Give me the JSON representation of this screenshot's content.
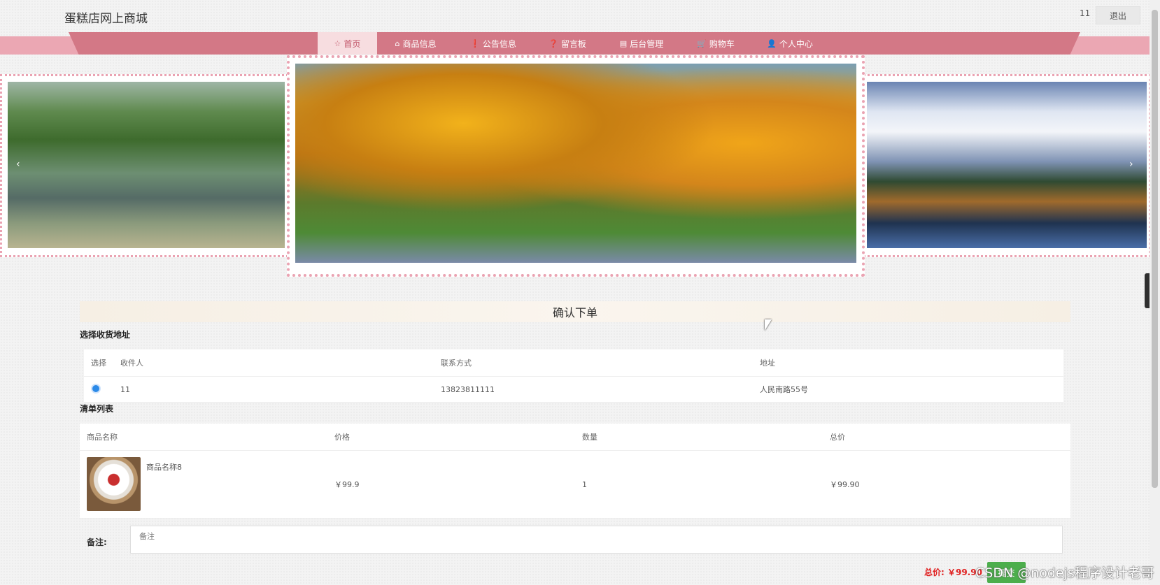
{
  "header": {
    "site_title": "蛋糕店网上商城",
    "user_name": "11",
    "logout_label": "退出"
  },
  "nav": [
    {
      "icon": "☆",
      "icon_name": "star-icon",
      "label": "首页",
      "active": true
    },
    {
      "icon": "⌂",
      "icon_name": "bag-icon",
      "label": "商品信息"
    },
    {
      "icon": "❗",
      "icon_name": "notice-icon",
      "label": "公告信息"
    },
    {
      "icon": "❓",
      "icon_name": "question-icon",
      "label": "留言板"
    },
    {
      "icon": "▤",
      "icon_name": "admin-icon",
      "label": "后台管理"
    },
    {
      "icon": "🛒",
      "icon_name": "cart-icon",
      "label": "购物车"
    },
    {
      "icon": "👤",
      "icon_name": "user-icon",
      "label": "个人中心"
    }
  ],
  "carousel": {
    "prev_glyph": "‹",
    "next_glyph": "›",
    "active_index": 0,
    "dot_count": 3
  },
  "order": {
    "heading": "确认下单",
    "address_section_title": "选择收货地址",
    "address_columns": [
      "选择",
      "收件人",
      "联系方式",
      "地址"
    ],
    "addresses": [
      {
        "selected": true,
        "recipient": "11",
        "phone": "13823811111",
        "address": "人民南路55号"
      }
    ],
    "items_section_title": "清单列表",
    "item_columns": [
      "商品名称",
      "价格",
      "数量",
      "总价"
    ],
    "items": [
      {
        "name": "商品名称8",
        "price": "￥99.9",
        "quantity": "1",
        "total": "￥99.90"
      }
    ],
    "remark_label": "备注:",
    "remark_placeholder": "备注",
    "total_label": "总价: ￥99.90",
    "submit_label": "提交"
  },
  "watermark": "CSDN @nodejs程序设计老哥",
  "side_handle_glyph": "›"
}
